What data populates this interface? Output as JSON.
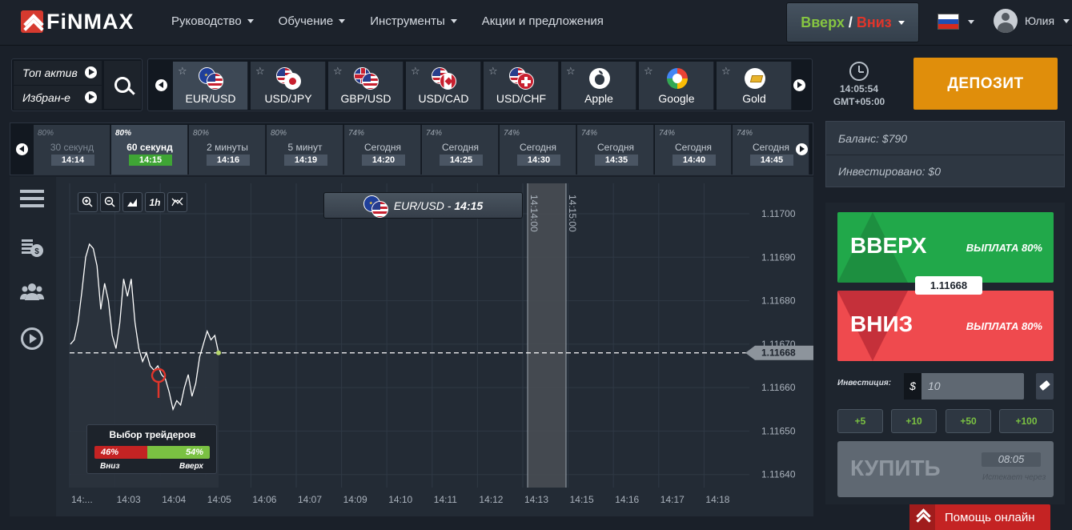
{
  "brand": {
    "name": "FiNMAX"
  },
  "nav": {
    "items": [
      {
        "label": "Руководство",
        "has_dropdown": true
      },
      {
        "label": "Обучение",
        "has_dropdown": true
      },
      {
        "label": "Инструменты",
        "has_dropdown": true
      },
      {
        "label": "Акции и предложения",
        "has_dropdown": false
      }
    ]
  },
  "mode_switch": {
    "up": "Вверх",
    "sep": "/",
    "down": "Вниз"
  },
  "language": {
    "flag": "ru"
  },
  "user": {
    "name": "Юлия"
  },
  "asset_tabs": {
    "top": "Топ актив",
    "favorites": "Избран-е"
  },
  "assets": [
    {
      "name": "EUR/USD",
      "icon": "eu-us-flags-icon",
      "active": true
    },
    {
      "name": "USD/JPY",
      "icon": "us-jp-flags-icon",
      "active": false
    },
    {
      "name": "GBP/USD",
      "icon": "gb-us-flags-icon",
      "active": false
    },
    {
      "name": "USD/CAD",
      "icon": "us-ca-flags-icon",
      "active": false
    },
    {
      "name": "USD/CHF",
      "icon": "us-ch-flags-icon",
      "active": false
    },
    {
      "name": "Apple",
      "icon": "apple-icon",
      "active": false
    },
    {
      "name": "Google",
      "icon": "google-icon",
      "active": false
    },
    {
      "name": "Gold",
      "icon": "gold-icon",
      "active": false
    }
  ],
  "clock": {
    "time": "14:05:54",
    "timezone": "GMT+05:00"
  },
  "deposit": {
    "label": "ДЕПОЗИТ"
  },
  "expiries": [
    {
      "pct": "80%",
      "label": "30 секунд",
      "time": "14:14",
      "active": false,
      "dim": true
    },
    {
      "pct": "80%",
      "label": "60 секунд",
      "time": "14:15",
      "active": true,
      "dim": false
    },
    {
      "pct": "80%",
      "label": "2 минуты",
      "time": "14:16",
      "active": false,
      "dim": false
    },
    {
      "pct": "80%",
      "label": "5 минут",
      "time": "14:19",
      "active": false,
      "dim": false
    },
    {
      "pct": "74%",
      "label": "Сегодня",
      "time": "14:20",
      "active": false,
      "dim": false
    },
    {
      "pct": "74%",
      "label": "Сегодня",
      "time": "14:25",
      "active": false,
      "dim": false
    },
    {
      "pct": "74%",
      "label": "Сегодня",
      "time": "14:30",
      "active": false,
      "dim": false
    },
    {
      "pct": "74%",
      "label": "Сегодня",
      "time": "14:35",
      "active": false,
      "dim": false
    },
    {
      "pct": "74%",
      "label": "Сегодня",
      "time": "14:40",
      "active": false,
      "dim": false
    },
    {
      "pct": "74%",
      "label": "Сегодня",
      "time": "14:45",
      "active": false,
      "dim": false
    }
  ],
  "chart": {
    "tools": [
      "zoom-in",
      "zoom-out",
      "chart-type",
      "1h",
      "indicators"
    ],
    "timeframe_label": "1h",
    "asset_label": "EUR/USD -",
    "asset_time": "14:15",
    "current_price": "1.11668",
    "vertical_markers": [
      "14:14:00",
      "14:15:00"
    ],
    "price_ticks": [
      "1.11700",
      "1.11690",
      "1.11680",
      "1.11670",
      "1.11660",
      "1.11650",
      "1.11640"
    ],
    "time_ticks": [
      "14:...",
      "14:03",
      "14:04",
      "14:05",
      "14:06",
      "14:07",
      "14:09",
      "14:10",
      "14:11",
      "14:12",
      "14:13",
      "14:15",
      "14:16",
      "14:17",
      "14:18"
    ]
  },
  "chart_data": {
    "type": "line",
    "title": "EUR/USD - 14:15",
    "xlabel": "",
    "ylabel": "",
    "ylim": [
      1.11637,
      1.11707
    ],
    "x_ticks": [
      "14:...",
      "14:03",
      "14:04",
      "14:05",
      "14:06",
      "14:07",
      "14:09",
      "14:10",
      "14:11",
      "14:12",
      "14:13",
      "14:15",
      "14:16",
      "14:17",
      "14:18"
    ],
    "y_ticks": [
      "1.11700",
      "1.11690",
      "1.11680",
      "1.11670",
      "1.11660",
      "1.11650",
      "1.11640"
    ],
    "series": [
      {
        "values": [
          1.1167,
          1.11671,
          1.11675,
          1.11682,
          1.1169,
          1.11693,
          1.11692,
          1.11688,
          1.11678,
          1.11684,
          1.1168,
          1.11672,
          1.11669,
          1.11675,
          1.11685,
          1.11681,
          1.11685,
          1.11675,
          1.11669,
          1.11666,
          1.11668,
          1.11665,
          1.11664,
          1.11665,
          1.11663,
          1.11662,
          1.11659,
          1.11655,
          1.11657,
          1.11656,
          1.1166,
          1.11663,
          1.11658,
          1.11661,
          1.11667,
          1.1167,
          1.11673,
          1.11671,
          1.11672,
          1.11668
        ]
      }
    ],
    "current_value": 1.11668,
    "grid": true
  },
  "sentiment": {
    "title": "Выбор трейдеров",
    "down_pct": "46%",
    "up_pct": "54%",
    "down_value": 46,
    "up_value": 54,
    "down_label": "Вниз",
    "up_label": "Вверх"
  },
  "account": {
    "balance": "Баланс: $790",
    "invested": "Инвестировано: $0"
  },
  "trade": {
    "up_label": "ВВЕРХ",
    "up_payout": "ВЫПЛАТА 80%",
    "down_label": "ВНИЗ",
    "down_payout": "ВЫПЛАТА 80%",
    "price": "1.11668",
    "investment_label": "Инвестиция:",
    "currency": "$",
    "investment_value": "10",
    "increments": [
      "+5",
      "+10",
      "+50",
      "+100"
    ],
    "buy_label": "КУПИТЬ",
    "buy_time": "08:05",
    "buy_sub": "Истекает через"
  },
  "help": {
    "label": "Помощь онлайн"
  },
  "colors": {
    "accent_orange": "#e08e0b",
    "up_green": "#21a84a",
    "down_red": "#ef4a4e",
    "brand_red": "#d63a2f"
  }
}
